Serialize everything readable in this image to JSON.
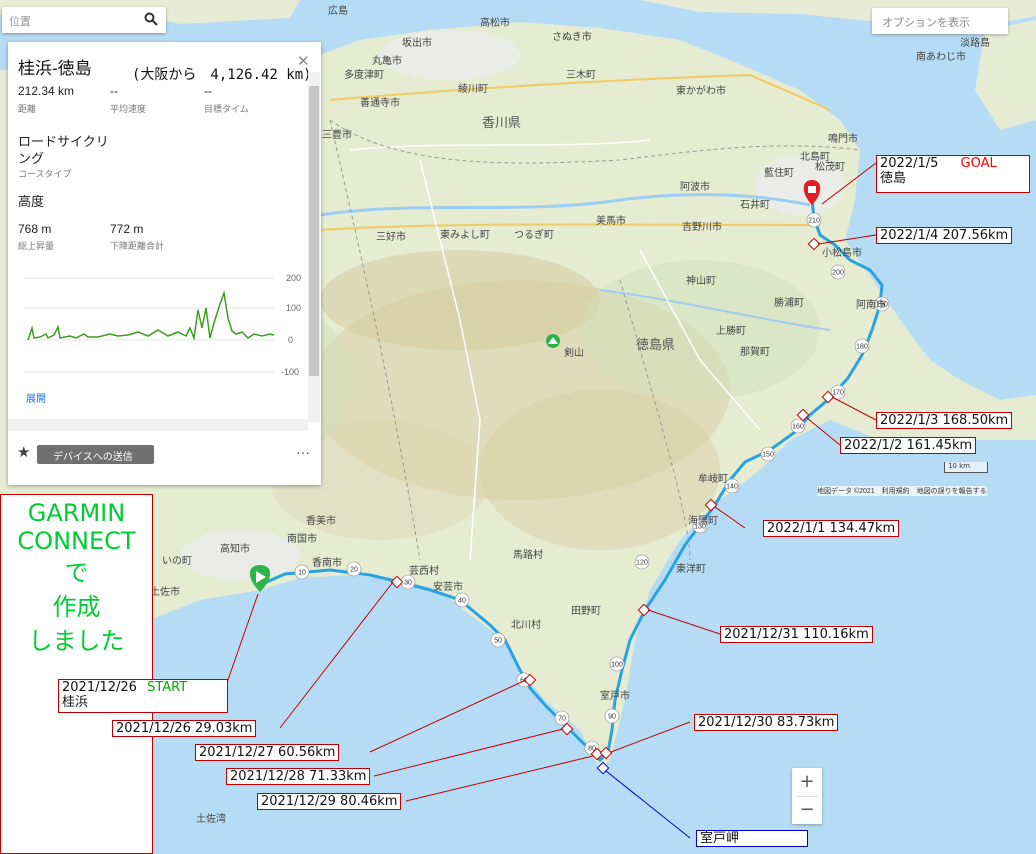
{
  "search": {
    "placeholder": "位置"
  },
  "options_label": "オプションを表示",
  "course": {
    "title": "桂浜-徳島",
    "distance_from_osaka": "(大阪から　4,126.42 km)",
    "stats": [
      {
        "value": "212.34 km",
        "label": "距離"
      },
      {
        "value": "--",
        "label": "平均速度"
      },
      {
        "value": "--",
        "label": "目標タイム"
      }
    ],
    "course_type_line1": "ロードサイクリ",
    "course_type_line2": "ング",
    "course_type_label": "コースタイプ",
    "elevation_heading": "高度",
    "ascent": {
      "value": "768 m",
      "label": "総上昇量"
    },
    "descent": {
      "value": "772 m",
      "label": "下降距離合計"
    },
    "expand_label": "展開",
    "send_label": "デバイスへの送信"
  },
  "elevation_chart": {
    "y_ticks": [
      "200",
      "100",
      "0",
      "-100"
    ]
  },
  "zoom": {
    "plus": "+",
    "minus": "−"
  },
  "map_attribution": "地図データ ©2021　利用規約　地図の誤りを報告する",
  "scale_label": "10 km",
  "map_labels": [
    "広島",
    "高松市",
    "さぬき市",
    "坂出市",
    "丸亀市",
    "多度津町",
    "綾川町",
    "三木町",
    "善通寺市",
    "香川県",
    "東かがわ市",
    "鳴門市",
    "三豊市",
    "阿波市",
    "藍住町",
    "北島町",
    "松茂町",
    "石井町",
    "美馬市",
    "吉野川市",
    "三好市",
    "東みよし町",
    "つるぎ町",
    "小松島市",
    "神山町",
    "勝浦町",
    "阿南市",
    "剣山",
    "徳島県",
    "上勝町",
    "那賀町",
    "牟岐町",
    "海陽町",
    "東洋町",
    "馬路村",
    "北川村",
    "安芸市",
    "芸西村",
    "香南市",
    "香美市",
    "南国市",
    "高知市",
    "いの町",
    "土佐市",
    "室戸市",
    "淡路島",
    "南あわじ市",
    "土佐湾",
    "田野町"
  ],
  "route_markers": [
    "10",
    "20",
    "30",
    "40",
    "50",
    "60",
    "70",
    "80",
    "90",
    "100",
    "120",
    "130",
    "140",
    "150",
    "160",
    "170",
    "180",
    "190",
    "200",
    "210"
  ],
  "callouts": {
    "goal_date": "2022/1/5",
    "goal_tag": "GOAL",
    "goal_place": "徳島",
    "d2022_1_4": "2022/1/4  207.56km",
    "d2022_1_3": "2022/1/3  168.50km",
    "d2022_1_2": "2022/1/2  161.45km",
    "d2022_1_1": "2022/1/1  134.47km",
    "d2021_12_31": "2021/12/31  110.16km",
    "d2021_12_30": "2021/12/30  83.73km",
    "start_date": "2021/12/26",
    "start_tag": "START",
    "start_place": "桂浜",
    "d2021_12_26": "2021/12/26   29.03km",
    "d2021_12_27": "2021/12/27   60.56km",
    "d2021_12_28": "2021/12/28   71.33km",
    "d2021_12_29": "2021/12/29   80.46km",
    "muroto": "室戸岬"
  },
  "garmin_note": [
    "GARMIN",
    "CONNECT",
    "で",
    "作成",
    "しました"
  ],
  "colors": {
    "route": "#29a3e0",
    "callout_border": "#c00000",
    "goal_tag": "#ff0000",
    "start_tag": "#00aa00",
    "note_text": "#00cc33",
    "sea": "#b6dcf5"
  }
}
